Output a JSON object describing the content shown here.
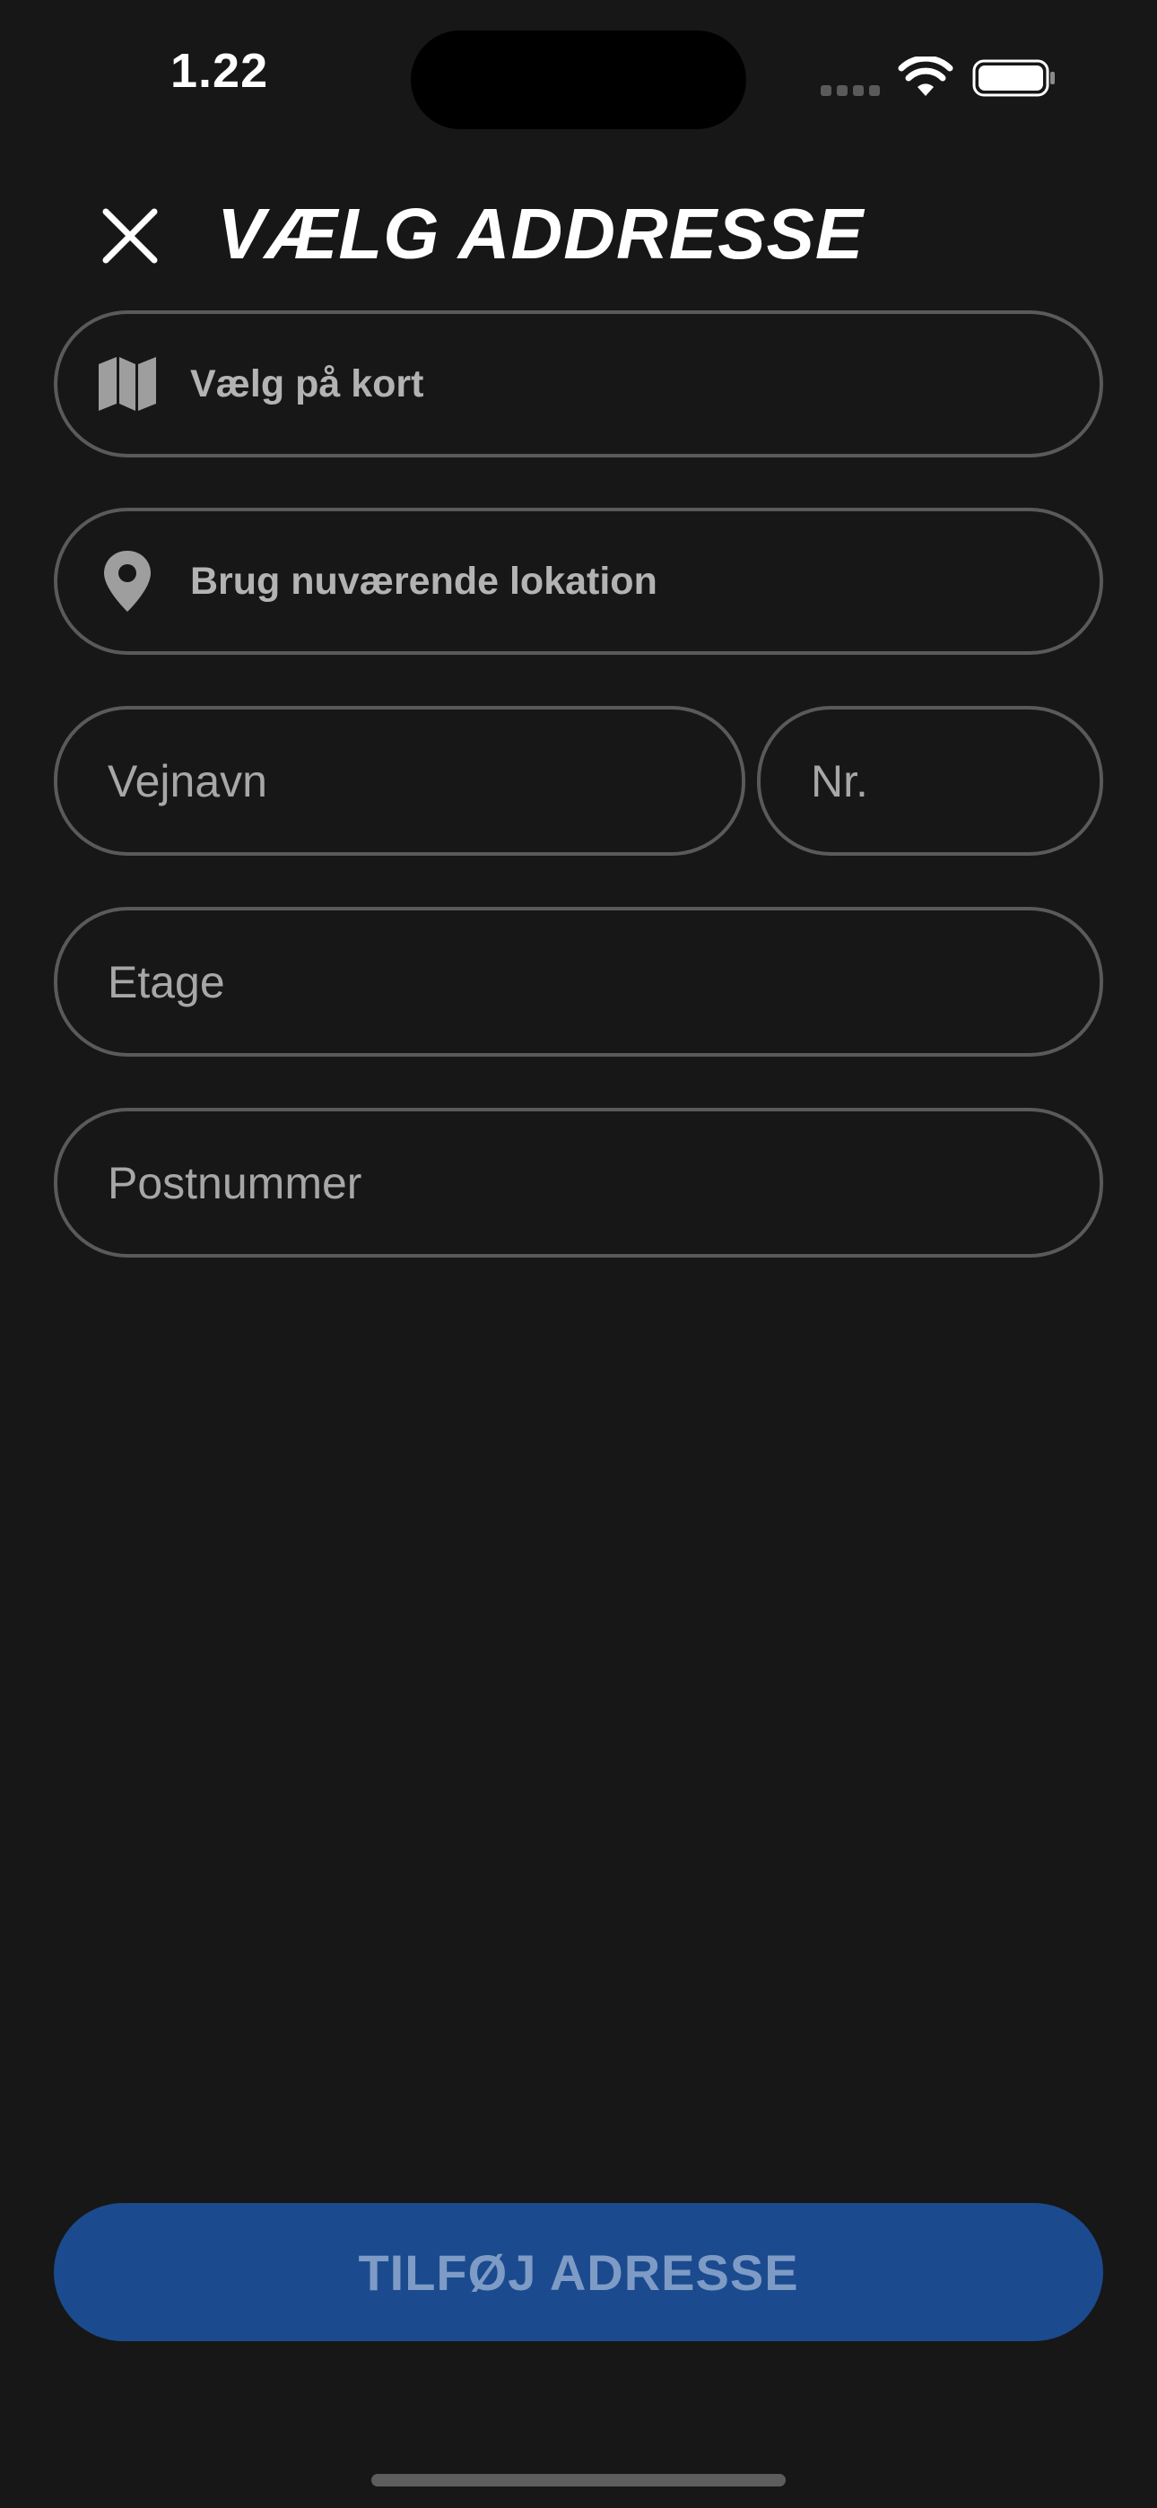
{
  "status_bar": {
    "time": "1.22"
  },
  "header": {
    "title": "VÆLG ADDRESSE",
    "close_icon": "close-icon"
  },
  "actions": [
    {
      "label": "Vælg på kort",
      "icon": "map-icon"
    },
    {
      "label": "Brug nuværende lokation",
      "icon": "location-pin-icon"
    }
  ],
  "form": {
    "street": {
      "placeholder": "Vejnavn",
      "value": ""
    },
    "number": {
      "placeholder": "Nr.",
      "value": ""
    },
    "floor": {
      "placeholder": "Etage",
      "value": ""
    },
    "postcode": {
      "placeholder": "Postnummer",
      "value": ""
    }
  },
  "submit": {
    "label": "TILFØJ ADRESSE"
  },
  "colors": {
    "background": "#171717",
    "field_border": "#5a5a5a",
    "button_bg": "#1b4b8e",
    "button_text": "#7e9bc6"
  }
}
